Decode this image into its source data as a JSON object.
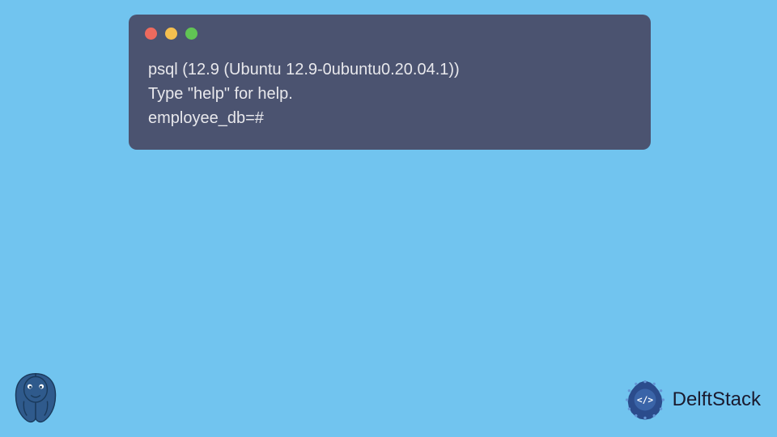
{
  "terminal": {
    "lines": [
      "psql (12.9 (Ubuntu 12.9-0ubuntu0.20.04.1))",
      "Type \"help\" for help.",
      "",
      "employee_db=#"
    ]
  },
  "branding": {
    "delft_label": "DelftStack"
  },
  "colors": {
    "background": "#71c4ef",
    "terminal_bg": "#4b5370",
    "terminal_text": "#e8e8ec",
    "traffic_red": "#ed6a5e",
    "traffic_yellow": "#f5bf4f",
    "traffic_green": "#61c454",
    "delft_primary": "#2b4c8c"
  }
}
